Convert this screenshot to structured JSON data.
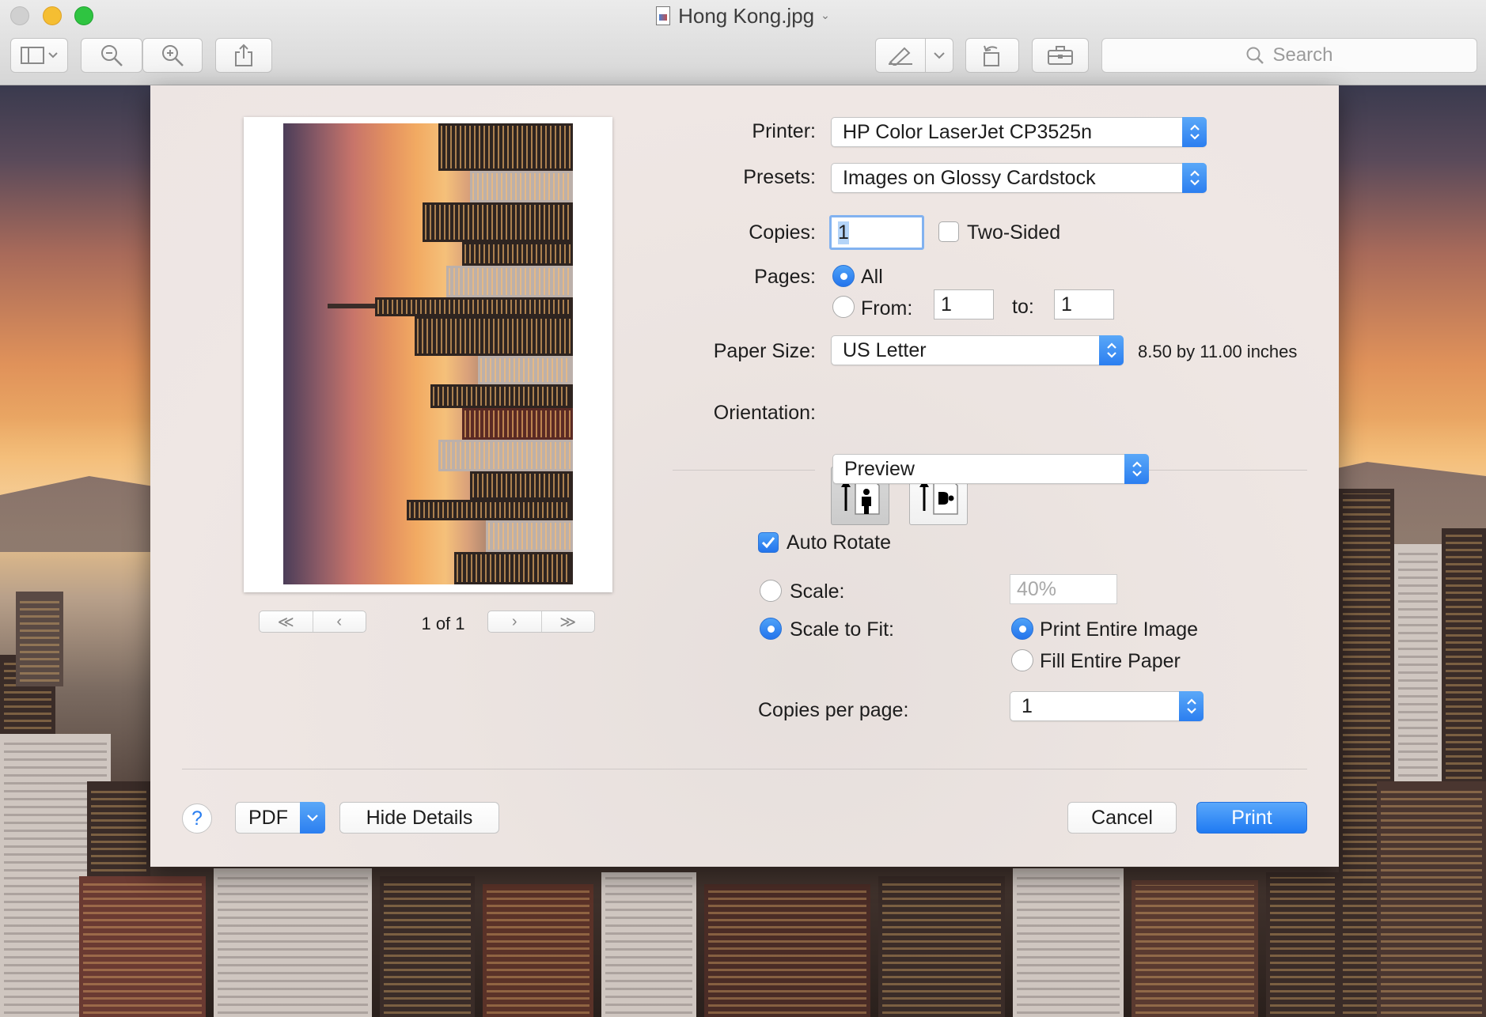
{
  "window": {
    "title": "Hong Kong.jpg"
  },
  "toolbar": {
    "search_placeholder": "Search"
  },
  "preview": {
    "page_count": "1 of 1"
  },
  "print": {
    "printer_label": "Printer:",
    "printer_value": "HP Color LaserJet CP3525n",
    "presets_label": "Presets:",
    "presets_value": "Images on Glossy Cardstock",
    "copies_label": "Copies:",
    "copies_value": "1",
    "two_sided_label": "Two-Sided",
    "pages_label": "Pages:",
    "pages_all": "All",
    "pages_from": "From:",
    "pages_from_value": "1",
    "pages_to": "to:",
    "pages_to_value": "1",
    "paper_size_label": "Paper Size:",
    "paper_size_value": "US Letter",
    "paper_dimensions": "8.50 by 11.00 inches",
    "orientation_label": "Orientation:",
    "section_value": "Preview",
    "auto_rotate": "Auto Rotate",
    "scale_label": "Scale:",
    "scale_value": "40%",
    "scale_to_fit": "Scale to Fit:",
    "print_entire_image": "Print Entire Image",
    "fill_entire_paper": "Fill Entire Paper",
    "copies_per_page_label": "Copies per page:",
    "copies_per_page_value": "1"
  },
  "footer": {
    "help": "?",
    "pdf": "PDF",
    "hide_details": "Hide Details",
    "cancel": "Cancel",
    "print": "Print"
  },
  "colors": {
    "accent": "#2a7ef0"
  }
}
